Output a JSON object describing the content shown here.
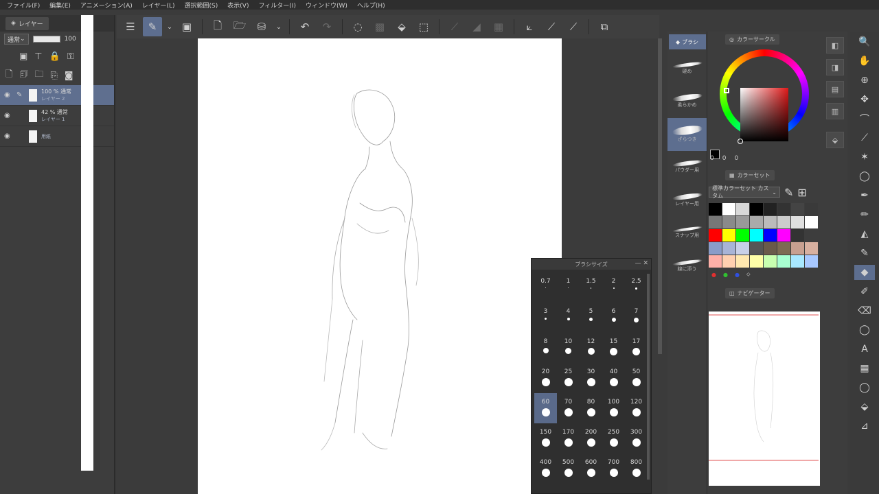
{
  "menu": [
    "ファイル(F)",
    "編集(E)",
    "アニメーション(A)",
    "レイヤー(L)",
    "選択範囲(S)",
    "表示(V)",
    "フィルター(I)",
    "ウィンドウ(W)",
    "ヘルプ(H)"
  ],
  "layer_panel": {
    "tab_label": "レイヤー",
    "blend_mode": "通常",
    "opacity": "100",
    "layers": [
      {
        "label": "100 % 通常",
        "name": "レイヤー 2"
      },
      {
        "label": "42 % 通常",
        "name": "レイヤー 1"
      },
      {
        "label": "",
        "name": "用紙"
      }
    ]
  },
  "brush_size": {
    "title": "ブラシサイズ",
    "sizes": [
      "0.7",
      "1",
      "1.5",
      "2",
      "2.5",
      "3",
      "4",
      "5",
      "6",
      "7",
      "8",
      "10",
      "12",
      "15",
      "17",
      "20",
      "25",
      "30",
      "40",
      "50",
      "60",
      "70",
      "80",
      "100",
      "120",
      "150",
      "170",
      "200",
      "250",
      "300",
      "400",
      "500",
      "600",
      "700",
      "800"
    ],
    "selected": "60"
  },
  "sub_tool": {
    "tab_label": "ブラシ",
    "presets": [
      "硬め",
      "柔らかめ",
      "ざらつき",
      "パウダー用",
      "レイヤー用",
      "スナップ用",
      "線に添う"
    ]
  },
  "color": {
    "wheel_tab": "カラーサークル",
    "set_tab": "カラーセット",
    "set_select": "標準カラーセット カスタム",
    "rgb_values": [
      "0",
      "0",
      "0"
    ],
    "fg_color": "#000000",
    "swatches": [
      "#000000",
      "#ffffff",
      "#d8d8d8",
      "#000000",
      "#222222",
      "#333333",
      "#444444",
      "#3a3a3a",
      "#777777",
      "#8a8a8a",
      "#999999",
      "#aaaaaa",
      "#bbbbbb",
      "#cccccc",
      "#e0e0e0",
      "#ffffff",
      "#ff0000",
      "#ffff00",
      "#00ff00",
      "#00ffff",
      "#0000ff",
      "#ff00ff",
      "#333333",
      "#3d3d3d",
      "#8a9cc8",
      "#a8b4d6",
      "#c8d0e8",
      "#555555",
      "#6a5a4a",
      "#7d6a52",
      "#c8a090",
      "#d8b0a0",
      "#ffb0a8",
      "#ffd0b0",
      "#ffe8b0",
      "#ffffa8",
      "#c8ffb0",
      "#a8ffd0",
      "#a8e8ff",
      "#a8c8ff"
    ]
  },
  "navigator": {
    "tab_label": "ナビゲーター"
  }
}
